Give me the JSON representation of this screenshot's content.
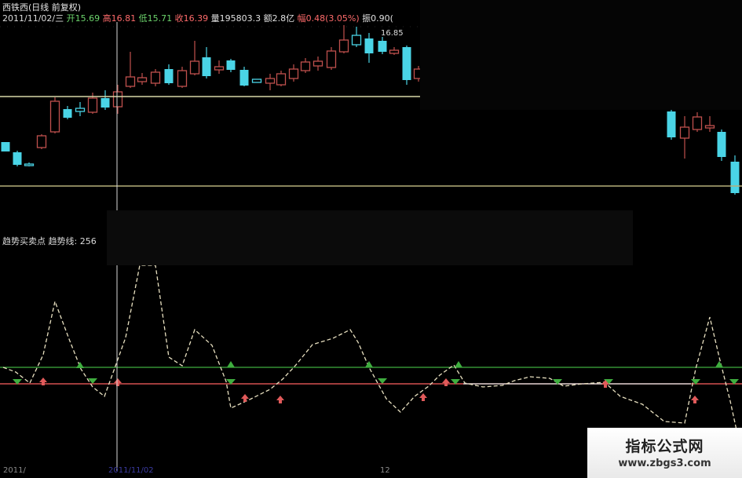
{
  "header": {
    "line1": "西铁西(日线 前复权)",
    "date": "2011/11/02/三",
    "open_label": "开",
    "open_value": "15.69",
    "high_label": "高",
    "high_value": "16.81",
    "low_label": "低",
    "low_value": "15.71",
    "close_label": "收",
    "close_value": "16.39",
    "volume_label": "量",
    "volume_value": "195803.3",
    "amount_label": "额",
    "amount_value": "2.8亿",
    "change_label": "幅",
    "change_value": "0.48(3.05%)",
    "amp_label": "振",
    "amp_value": "0.90(",
    "peak_label": "16.85"
  },
  "indicator": {
    "title": "趋势买卖点",
    "trend_label": "趋势线:",
    "trend_value": "256"
  },
  "footer": {
    "date_left": "2011/",
    "date_cursor": "2011/11/02",
    "date_right": "12"
  },
  "watermark": {
    "title": "指标公式网",
    "url": "www.zbgs3.com"
  },
  "colors": {
    "up_candle": "#c0504d",
    "down_candle": "#4ad4e6",
    "upper_hline": "#d8d7a8",
    "lower_hline": "#b5b07a",
    "green_line": "#3fae3f",
    "red_line": "#ff6060",
    "trend_line": "#e8e0c0",
    "crosshair": "#d8d8d8"
  }
}
